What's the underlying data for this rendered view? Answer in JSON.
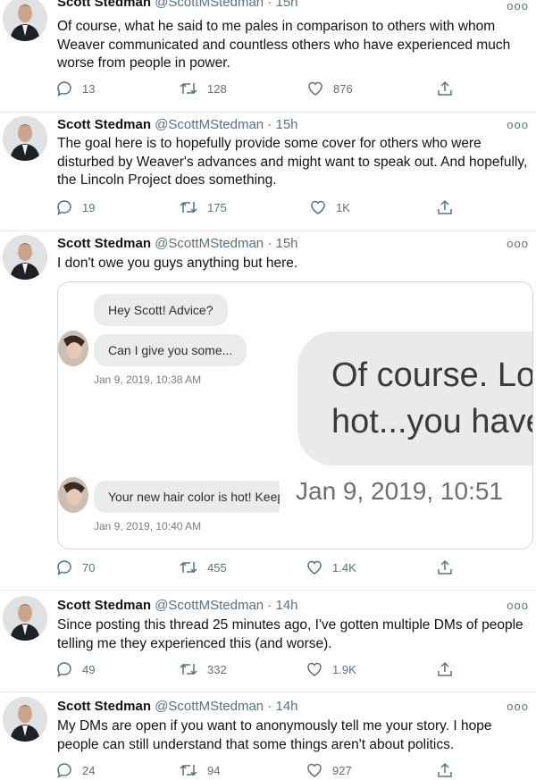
{
  "colors": {
    "text": "#0f1419",
    "secondary": "#5b7083",
    "border": "#cfd9de",
    "bubble": "#ebebeb"
  },
  "tweets": [
    {
      "name": "Scott Stedman",
      "handle": "@ScottMStedman",
      "time": "· 15h",
      "text": "Of course, what he said to me pales in comparison to others with whom Weaver communicated and countless others who have experienced much worse from people in power.",
      "replies": "13",
      "retweets": "128",
      "likes": "876"
    },
    {
      "name": "Scott Stedman",
      "handle": "@ScottMStedman",
      "time": "· 15h",
      "text": "The goal here is to hopefully provide some cover for others who were disturbed by Weaver's advances and might want to speak out. And hopefully, the Lincoln Project does something.",
      "replies": "19",
      "retweets": "175",
      "likes": "1K"
    },
    {
      "name": "Scott Stedman",
      "handle": "@ScottMStedman",
      "time": "· 15h",
      "text": "I don't owe you guys anything but here.",
      "replies": "70",
      "retweets": "455",
      "likes": "1.4K",
      "media": {
        "bubble1": "Hey Scott! Advice?",
        "bubble2": "Can I give you some...",
        "time1": "Jan 9, 2019, 10:38 AM",
        "big_line1": "Of course. Lo",
        "big_line2": "hot...you have",
        "bubble3": "Your new hair color is hot! Keep",
        "big_time": "Jan 9, 2019, 10:51",
        "time2": "Jan 9, 2019, 10:40 AM"
      }
    },
    {
      "name": "Scott Stedman",
      "handle": "@ScottMStedman",
      "time": "· 14h",
      "text": "Since posting this thread 25 minutes ago, I've gotten multiple DMs of people telling me they experienced this (and worse).",
      "replies": "49",
      "retweets": "332",
      "likes": "1.9K"
    },
    {
      "name": "Scott Stedman",
      "handle": "@ScottMStedman",
      "time": "· 14h",
      "text": "My DMs are open if you want to anonymously tell me your story. I hope people can still understand that some things aren't about politics.",
      "replies": "24",
      "retweets": "94",
      "likes": "927"
    }
  ]
}
